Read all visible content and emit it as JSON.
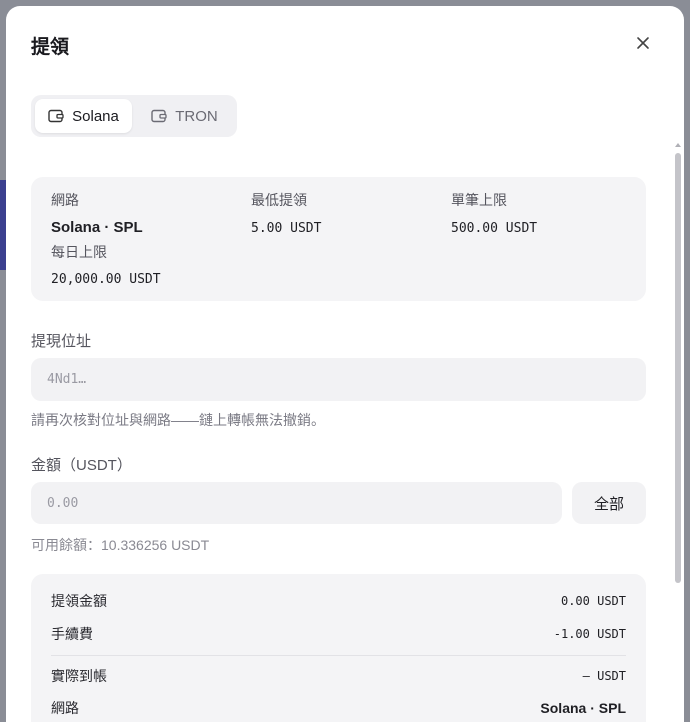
{
  "dialog": {
    "title": "提領"
  },
  "network_tabs": [
    {
      "label": "Solana",
      "icon": "wallet-icon",
      "active": true
    },
    {
      "label": "TRON",
      "icon": "wallet-icon",
      "active": false
    }
  ],
  "info": {
    "network_label": "網路",
    "network_value": "Solana · SPL",
    "min_label": "最低提領",
    "min_value": "5.00 USDT",
    "single_max_label": "單筆上限",
    "single_max_value": "500.00 USDT",
    "daily_label": "每日上限",
    "daily_value": "20,000.00 USDT"
  },
  "address": {
    "label": "提現位址",
    "placeholder": "4Nd1…",
    "warning": "請再次核對位址與網路——鏈上轉帳無法撤銷。"
  },
  "amount": {
    "label": "金額（USDT）",
    "placeholder": "0.00",
    "all_button": "全部",
    "available": "可用餘額：10.336256 USDT"
  },
  "summary": {
    "rows": [
      {
        "label": "提領金額",
        "value": "0.00 USDT"
      },
      {
        "label": "手續費",
        "value": "-1.00 USDT"
      },
      {
        "label": "實際到帳",
        "value": "— USDT"
      },
      {
        "label": "網路",
        "value": "Solana · SPL"
      }
    ]
  },
  "colors": {
    "modal_bg": "#ffffff",
    "card_bg": "#f4f4f6",
    "field_bg": "#f2f2f4",
    "backdrop": "#8a8d96"
  }
}
